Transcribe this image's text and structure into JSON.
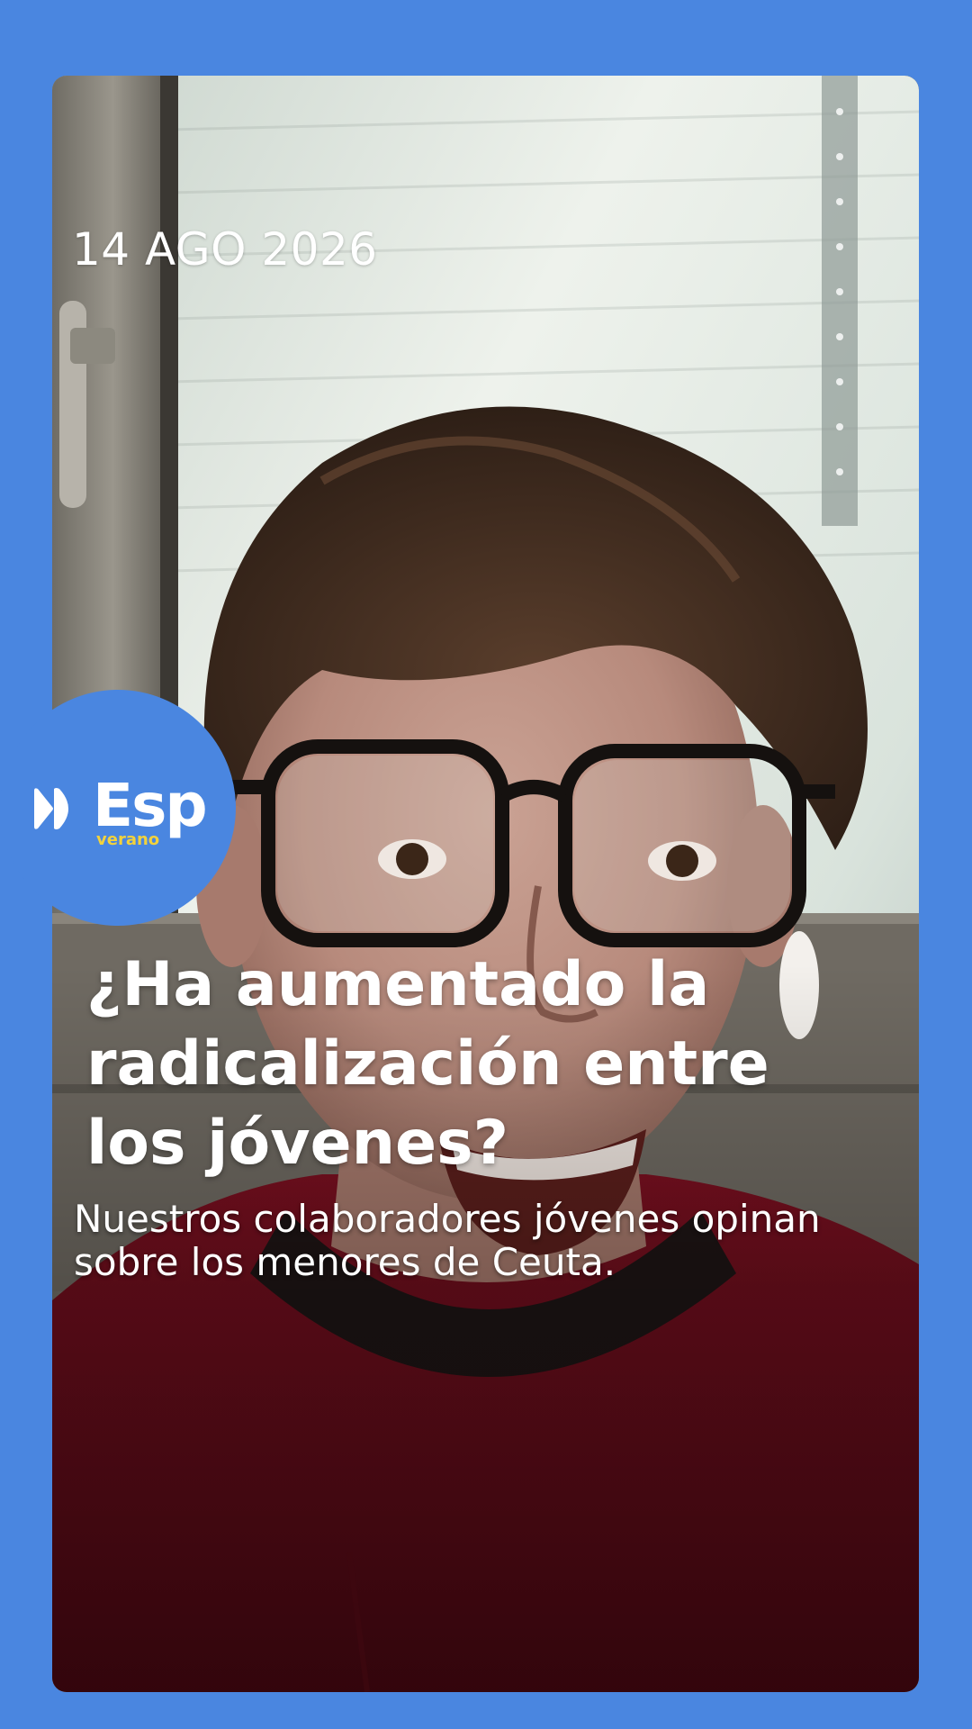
{
  "story": {
    "date": "14 AGO 2026",
    "headline_lines": [
      "¿Ha aumentado la",
      "radicalización entre",
      "los jóvenes?"
    ],
    "subtitle_lines": [
      "Nuestros colaboradores jóvenes opinan",
      "sobre los menores de Ceuta."
    ]
  },
  "logo": {
    "icon": "play-icon",
    "name": "Esp",
    "tagline": "verano",
    "tagline_color": "#f2d23c"
  },
  "colors": {
    "background": "#4a86e0",
    "text": "#ffffff"
  }
}
